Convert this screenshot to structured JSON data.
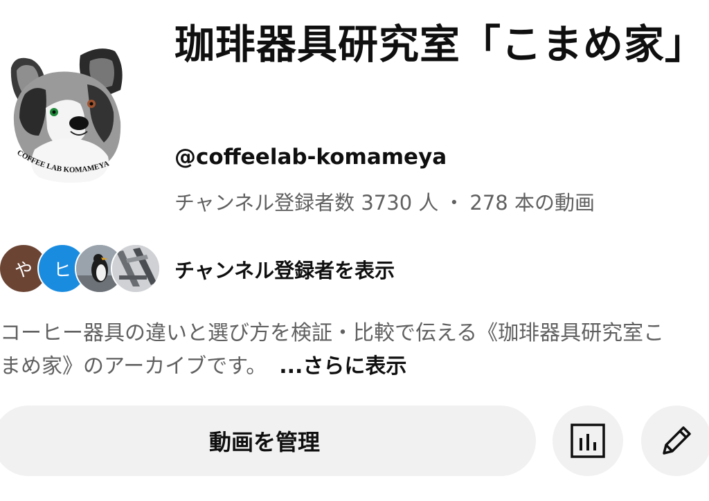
{
  "channel": {
    "title": "珈琲器具研究室「こまめ家」",
    "handle": "@coffeelab-komameya",
    "subscriber_count": "チャンネル登録者数 3730 人",
    "separator": "・",
    "video_count": "278 本の動画",
    "avatar_logo_text": "COFFEE LAB KOMAMEYA"
  },
  "subscribers": {
    "avatars": [
      {
        "letter": "や",
        "color": "#6b4434"
      },
      {
        "letter": "ヒ",
        "color": "#1a8ce0"
      }
    ],
    "label": "チャンネル登録者を表示"
  },
  "description": {
    "line1": "コーヒー器具の違いと選び方を検証・比較で伝える《珈琲器具研究室こ",
    "line2": "まめ家》のアーカイブです。",
    "more": "...さらに表示"
  },
  "actions": {
    "manage_videos": "動画を管理",
    "analytics_icon": "analytics-icon",
    "edit_icon": "pencil-icon"
  }
}
